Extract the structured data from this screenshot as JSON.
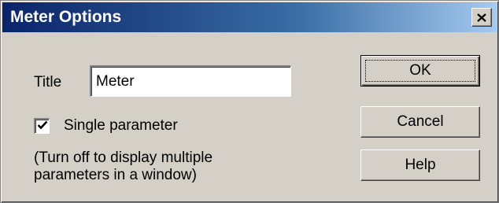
{
  "window": {
    "title": "Meter Options"
  },
  "form": {
    "title_label": "Title",
    "title_value": "Meter",
    "single_parameter_label": "Single parameter",
    "single_parameter_checked": true,
    "note_line1": "(Turn off to display multiple",
    "note_line2": "parameters in a window)"
  },
  "buttons": {
    "ok": "OK",
    "cancel": "Cancel",
    "help": "Help"
  },
  "icons": {
    "close": "close-icon",
    "check": "checkmark-icon"
  },
  "colors": {
    "titlebar_start": "#0a246a",
    "titlebar_end": "#a6caf0",
    "face": "#d4d0c8"
  }
}
